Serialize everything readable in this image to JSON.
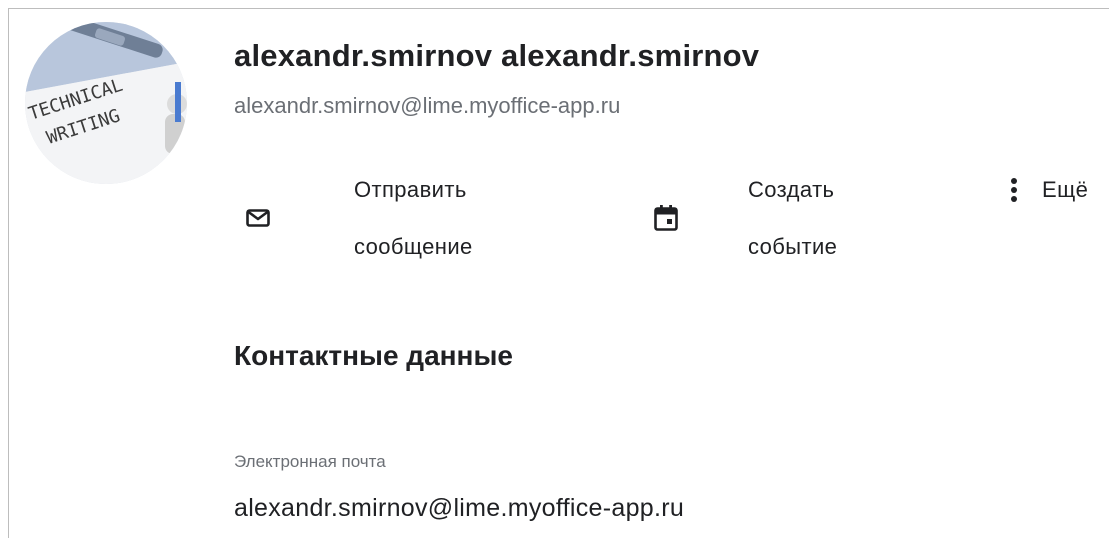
{
  "contact": {
    "name": "alexandr.smirnov alexandr.smirnov",
    "email": "alexandr.smirnov@lime.myoffice-app.ru",
    "avatar_text": [
      "TECHNICAL",
      "WRITING"
    ]
  },
  "actions": {
    "send_message": {
      "line1": "Отправить",
      "line2": "сообщение",
      "icon": "mail-icon"
    },
    "create_event": {
      "line1": "Создать",
      "line2": "событие",
      "icon": "calendar-icon"
    },
    "more": {
      "label": "Ещё",
      "icon": "more-vertical-icon"
    }
  },
  "contact_details": {
    "title": "Контактные данные",
    "email_label": "Электронная почта",
    "email_value": "alexandr.smirnov@lime.myoffice-app.ru"
  },
  "colors": {
    "text": "#202124",
    "secondary_text": "#6b6f75",
    "border": "#bdbdbd"
  }
}
